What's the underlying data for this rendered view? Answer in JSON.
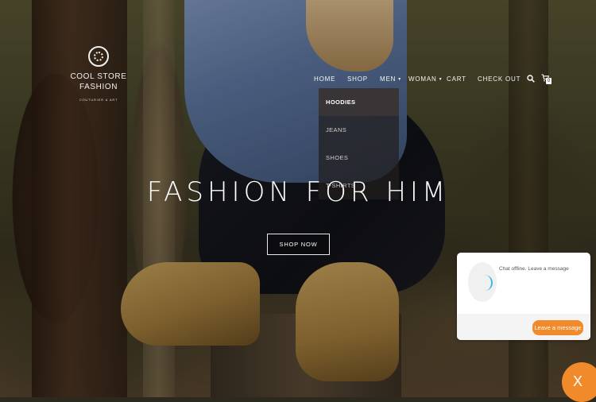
{
  "logo": {
    "line1": "COOL STORE",
    "line2": "FASHION",
    "tagline": "COUTURIER & ART"
  },
  "nav": {
    "items": [
      {
        "label": "HOME"
      },
      {
        "label": "SHOP"
      },
      {
        "label": "MEN"
      },
      {
        "label": "WOMAN"
      },
      {
        "label": "CART"
      },
      {
        "label": "CHECK OUT"
      }
    ],
    "cart_count": "0",
    "icons": [
      "search-icon",
      "cart-icon"
    ]
  },
  "dropdown": {
    "items": [
      {
        "label": "HOODIES"
      },
      {
        "label": "JEANS"
      },
      {
        "label": "SHOES"
      },
      {
        "label": "T-SHIRTS"
      }
    ]
  },
  "hero": {
    "headline": "FASHION FOR HIM",
    "button": "SHOP NOW"
  },
  "chat": {
    "status": "Chat offline. Leave a message",
    "button": "Leave a message",
    "close": "X",
    "accent": "#f08a2a"
  }
}
